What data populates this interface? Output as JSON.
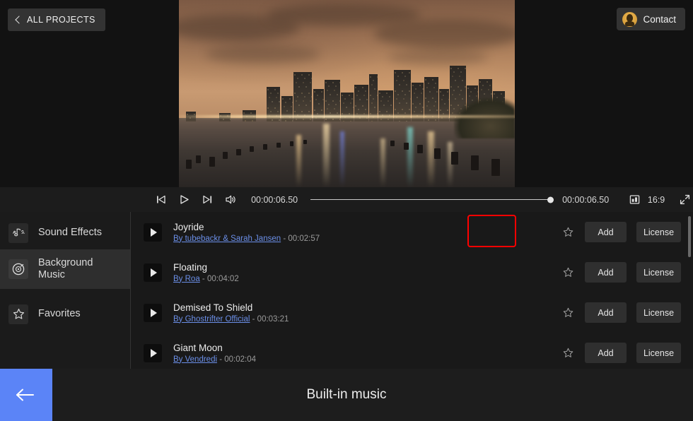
{
  "header": {
    "all_projects_label": "ALL PROJECTS",
    "contact_label": "Contact"
  },
  "preview": {
    "scene_description": "New York City skyline at dusk reflected in water"
  },
  "transport": {
    "current_time": "00:00:06.50",
    "total_time": "00:00:06.50",
    "aspect_ratio": "16:9",
    "slider_position_percent": 100
  },
  "sidebar": {
    "items": [
      {
        "label": "Sound Effects",
        "icon": "sound-wave-icon",
        "active": false
      },
      {
        "label": "Background Music",
        "icon": "vinyl-disc-icon",
        "active": true
      },
      {
        "label": "Favorites",
        "icon": "star-icon",
        "active": false
      }
    ]
  },
  "music_list": {
    "add_label": "Add",
    "license_label": "License",
    "tracks": [
      {
        "title": "Joyride",
        "artist": "By tubebackr & Sarah Jansen",
        "separator": " - ",
        "duration": "00:02:57",
        "highlighted": true
      },
      {
        "title": "Floating",
        "artist": "By Roa",
        "separator": " - ",
        "duration": "00:04:02",
        "highlighted": false
      },
      {
        "title": "Demised To Shield",
        "artist": "By Ghostrifter Official",
        "separator": " - ",
        "duration": "00:03:21",
        "highlighted": false
      },
      {
        "title": "Giant Moon",
        "artist": "By Vendredi",
        "separator": " - ",
        "duration": "00:02:04",
        "highlighted": false
      }
    ]
  },
  "bottom": {
    "title": "Built-in music",
    "back_icon": "arrow-left-icon"
  },
  "colors": {
    "accent_blue": "#5b84f7",
    "highlight_red": "#ff0000",
    "link_blue": "#6b8fe8",
    "avatar_gold": "#dba33e"
  }
}
